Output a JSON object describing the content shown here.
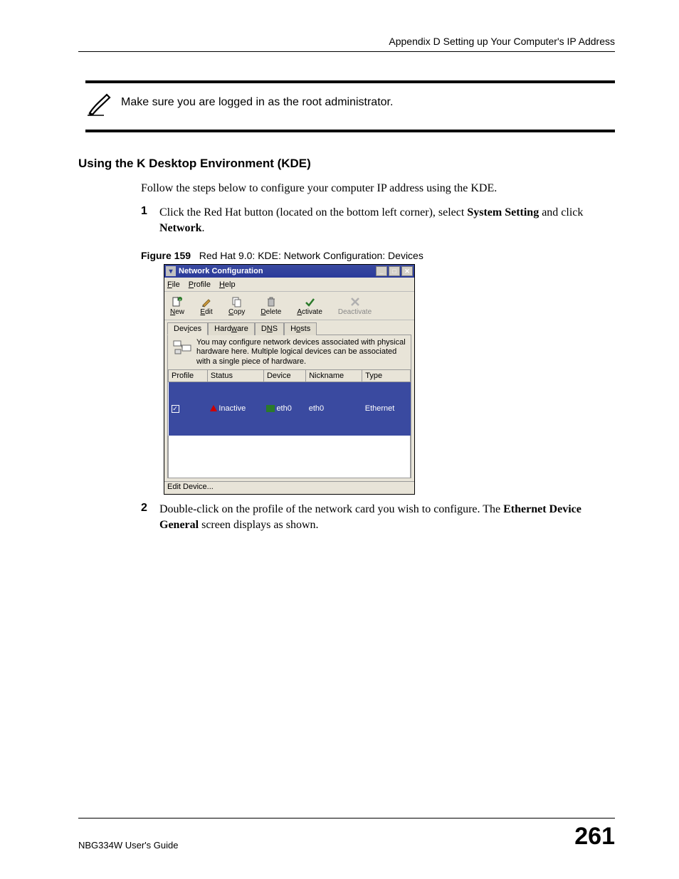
{
  "header": "Appendix D Setting up Your Computer's IP Address",
  "note": "Make sure you are logged in as the root administrator.",
  "section_heading": "Using the K Desktop Environment (KDE)",
  "follow_text": "Follow the steps below to configure your computer IP address using the KDE.",
  "steps": {
    "s1": {
      "num": "1",
      "pre": "Click the Red Hat button (located on the bottom left corner), select ",
      "b1": "System Setting",
      "mid": " and click ",
      "b2": "Network",
      "post": "."
    },
    "s2": {
      "num": "2",
      "pre": "Double-click on the profile of the network card you wish to configure. The ",
      "b1": "Ethernet Device General",
      "post": " screen displays as shown."
    }
  },
  "figure": {
    "label": "Figure 159",
    "caption": "Red Hat 9.0: KDE: Network Configuration: Devices"
  },
  "win": {
    "title": "Network Configuration",
    "menu": {
      "file": "File",
      "profile": "Profile",
      "help": "Help"
    },
    "toolbar": {
      "new": "New",
      "edit": "Edit",
      "copy": "Copy",
      "delete": "Delete",
      "activate": "Activate",
      "deactivate": "Deactivate"
    },
    "tabs": {
      "devices": "Devices",
      "hardware": "Hardware",
      "dns": "DNS",
      "hosts": "Hosts"
    },
    "info": "You may configure network devices associated with physical hardware here.  Multiple logical devices can be associated with a single piece of hardware.",
    "cols": {
      "profile": "Profile",
      "status": "Status",
      "device": "Device",
      "nickname": "Nickname",
      "type": "Type"
    },
    "row": {
      "checked": "✓",
      "status": "Inactive",
      "device": "eth0",
      "nickname": "eth0",
      "type": "Ethernet"
    },
    "statusbar": "Edit Device..."
  },
  "footer": {
    "left": "NBG334W User's Guide",
    "page": "261"
  }
}
